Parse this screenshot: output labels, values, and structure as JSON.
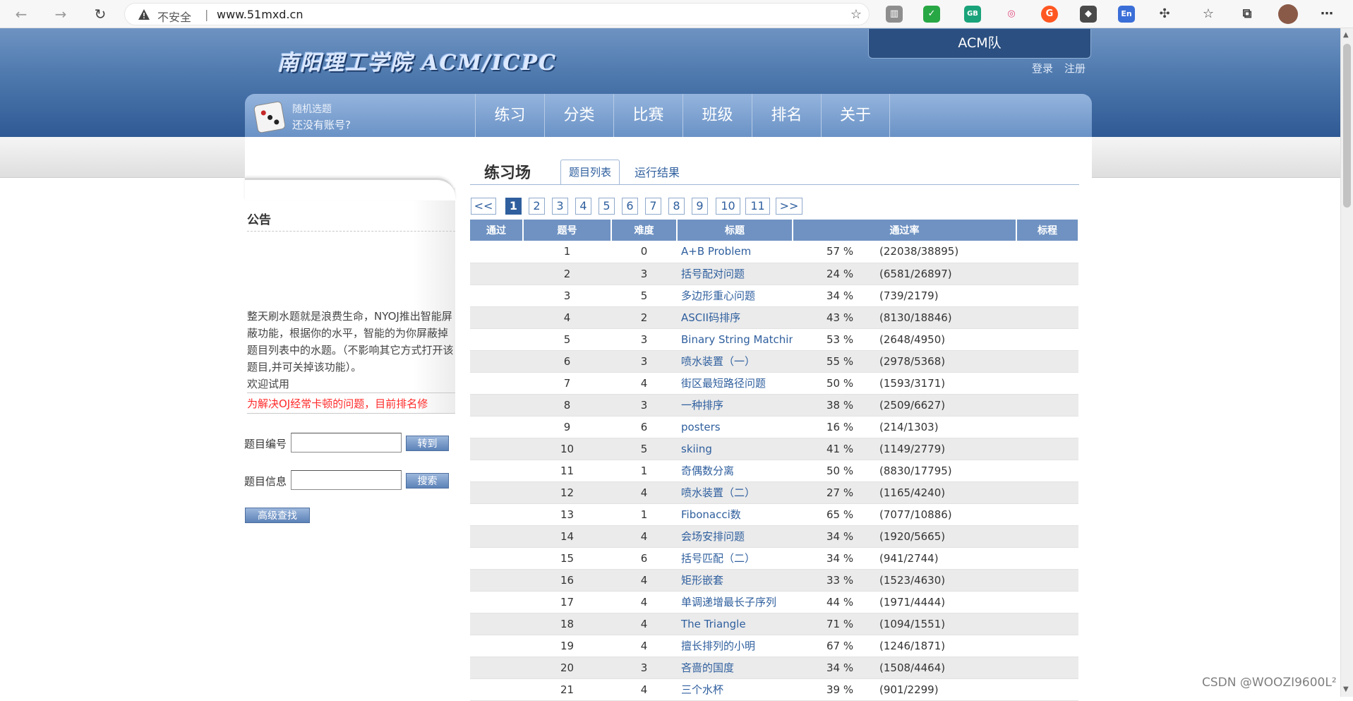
{
  "browser": {
    "secure_label": "不安全",
    "separator": "|",
    "url": "www.51mxd.cn",
    "ext_badge": "GB",
    "ext_translate": "En"
  },
  "header": {
    "logo": "南阳理工学院 ACM/ICPC",
    "acm_tab": "ACM队",
    "login": "登录",
    "register": "注册"
  },
  "nav": {
    "random_label": "随机选题",
    "no_account": "还没有账号?",
    "items": [
      "练习",
      "分类",
      "比赛",
      "班级",
      "排名",
      "关于"
    ]
  },
  "sidebar": {
    "notice_title": "公告",
    "notice_body": "整天刷水题就是浪费生命，NYOJ推出智能屏蔽功能，根据你的水平，智能的为你屏蔽掉题目列表中的水题。（不影响其它方式打开该题目,并可关掉该功能）。",
    "welcome": "欢迎试用",
    "red_notice": "为解决OJ经常卡顿的问题，目前排名修",
    "problem_id_label": "题目编号",
    "goto_button": "转到",
    "problem_info_label": "题目信息",
    "search_button": "搜索",
    "advanced_search": "高级查找"
  },
  "main": {
    "title": "练习场",
    "tab_list": "题目列表",
    "tab_results": "运行结果",
    "pager": [
      "<<",
      "1",
      "2",
      "3",
      "4",
      "5",
      "6",
      "7",
      "8",
      "9",
      "10",
      "11",
      ">>"
    ],
    "active_page": "1",
    "columns": [
      "通过",
      "题号",
      "难度",
      "标题",
      "通过率",
      "标程"
    ],
    "rows": [
      {
        "id": "1",
        "diff": "0",
        "title": "A+B Problem",
        "rate": "57 %",
        "counts": "(22038/38895)"
      },
      {
        "id": "2",
        "diff": "3",
        "title": "括号配对问题",
        "rate": "24 %",
        "counts": "(6581/26897)"
      },
      {
        "id": "3",
        "diff": "5",
        "title": "多边形重心问题",
        "rate": "34 %",
        "counts": "(739/2179)"
      },
      {
        "id": "4",
        "diff": "2",
        "title": "ASCII码排序",
        "rate": "43 %",
        "counts": "(8130/18846)"
      },
      {
        "id": "5",
        "diff": "3",
        "title": "Binary String Matching",
        "rate": "53 %",
        "counts": "(2648/4950)"
      },
      {
        "id": "6",
        "diff": "3",
        "title": "喷水装置（一）",
        "rate": "55 %",
        "counts": "(2978/5368)"
      },
      {
        "id": "7",
        "diff": "4",
        "title": "街区最短路径问题",
        "rate": "50 %",
        "counts": "(1593/3171)"
      },
      {
        "id": "8",
        "diff": "3",
        "title": "一种排序",
        "rate": "38 %",
        "counts": "(2509/6627)"
      },
      {
        "id": "9",
        "diff": "6",
        "title": "posters",
        "rate": "16 %",
        "counts": "(214/1303)"
      },
      {
        "id": "10",
        "diff": "5",
        "title": "skiing",
        "rate": "41 %",
        "counts": "(1149/2779)"
      },
      {
        "id": "11",
        "diff": "1",
        "title": "奇偶数分离",
        "rate": "50 %",
        "counts": "(8830/17795)"
      },
      {
        "id": "12",
        "diff": "4",
        "title": "喷水装置（二）",
        "rate": "27 %",
        "counts": "(1165/4240)"
      },
      {
        "id": "13",
        "diff": "1",
        "title": "Fibonacci数",
        "rate": "65 %",
        "counts": "(7077/10886)"
      },
      {
        "id": "14",
        "diff": "4",
        "title": "会场安排问题",
        "rate": "34 %",
        "counts": "(1920/5665)"
      },
      {
        "id": "15",
        "diff": "6",
        "title": "括号匹配（二）",
        "rate": "34 %",
        "counts": "(941/2744)"
      },
      {
        "id": "16",
        "diff": "4",
        "title": "矩形嵌套",
        "rate": "33 %",
        "counts": "(1523/4630)"
      },
      {
        "id": "17",
        "diff": "4",
        "title": "单调递增最长子序列",
        "rate": "44 %",
        "counts": "(1971/4444)"
      },
      {
        "id": "18",
        "diff": "4",
        "title": "The Triangle",
        "rate": "71 %",
        "counts": "(1094/1551)"
      },
      {
        "id": "19",
        "diff": "4",
        "title": "擅长排列的小明",
        "rate": "67 %",
        "counts": "(1246/1871)"
      },
      {
        "id": "20",
        "diff": "3",
        "title": "吝啬的国度",
        "rate": "34 %",
        "counts": "(1508/4464)"
      },
      {
        "id": "21",
        "diff": "4",
        "title": "三个水杯",
        "rate": "39 %",
        "counts": "(901/2299)"
      }
    ]
  },
  "watermark": "CSDN @WOOZI9600L²"
}
